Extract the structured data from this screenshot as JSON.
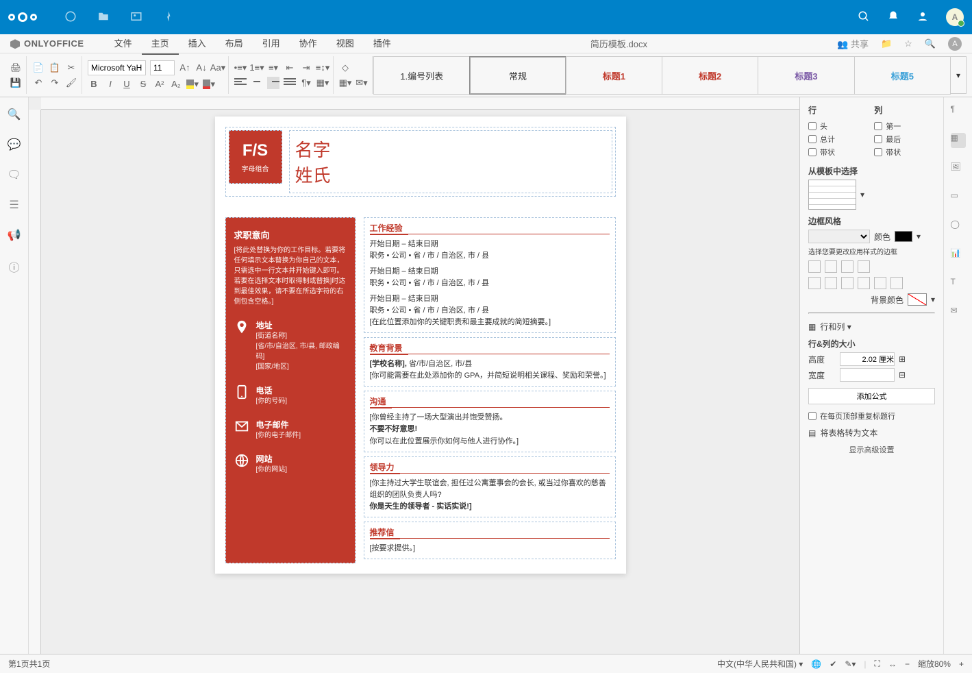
{
  "nextcloud_user_initial": "A",
  "oo": {
    "brand": "ONLYOFFICE",
    "doc_title": "简历模板.docx",
    "share": "共享",
    "user_initial": "A"
  },
  "tabs": [
    "文件",
    "主页",
    "插入",
    "布局",
    "引用",
    "协作",
    "视图",
    "插件"
  ],
  "active_tab": 1,
  "font": {
    "name": "Microsoft YaH",
    "size": "11"
  },
  "styles": [
    {
      "label": "1.编号列表",
      "color": "#333"
    },
    {
      "label": "常规",
      "color": "#333",
      "selected": true
    },
    {
      "label": "标题1",
      "color": "#c0392b",
      "bold": true
    },
    {
      "label": "标题2",
      "color": "#c0392b",
      "bold": true
    },
    {
      "label": "标题3",
      "color": "#7b5aa6",
      "bold": true
    },
    {
      "label": "标题5",
      "color": "#3aa0d8",
      "bold": true
    }
  ],
  "doc": {
    "fs": "F/S",
    "fs_sub": "字母组合",
    "first_name": "名字",
    "last_name": "姓氏",
    "objective_title": "求职意向",
    "objective_text": "[将此处替换为你的工作目标。若要将任何填示文本替换为你自己的文本，只需选中一行文本并开始键入即可。若要在选择文本时取得制或替换]时达到最佳效果，请不要在所选字符的右侧包含空格。]",
    "contacts": [
      {
        "icon": "pin",
        "title": "地址",
        "lines": [
          "[街道名称]",
          "[省/市/自治区, 市/县, 邮政编码]",
          "[国家/地区]"
        ]
      },
      {
        "icon": "phone",
        "title": "电话",
        "lines": [
          "[你的号码]"
        ]
      },
      {
        "icon": "mail",
        "title": "电子邮件",
        "lines": [
          "[你的电子邮件]"
        ]
      },
      {
        "icon": "globe",
        "title": "网站",
        "lines": [
          "[你的网站]"
        ]
      }
    ],
    "sections": {
      "work": {
        "title": "工作经验",
        "items": [
          {
            "date": "开始日期 – 结束日期",
            "line": "职务 • 公司 • 省 / 市 / 自治区, 市 / 县"
          },
          {
            "date": "开始日期 – 结束日期",
            "line": "职务 • 公司 • 省 / 市 / 自治区, 市 / 县"
          },
          {
            "date": "开始日期 – 结束日期",
            "line": "职务 • 公司 • 省 / 市 / 自治区, 市 / 县",
            "extra": "[在此位置添加你的关键职责和最主要成就的简短摘要。]"
          }
        ]
      },
      "edu": {
        "title": "教育背景",
        "school": "[学校名称],",
        "loc": "省/市/自治区, 市/县",
        "extra": "[你可能需要在此处添加你的 GPA，并简短说明相关课程、奖励和荣誉。]"
      },
      "comm": {
        "title": "沟通",
        "l1": "[你曾经主持了一场大型演出并饱受赞扬。",
        "l2": "不要不好意思!",
        "l3": "你可以在此位置展示你如何与他人进行协作。]"
      },
      "lead": {
        "title": "领导力",
        "l1": "[你主持过大学生联谊会, 担任过公寓董事会的会长, 或当过你喜欢的慈善组织的团队负责人吗?",
        "l2": "你是天生的领导者 - 实话实说!]"
      },
      "ref": {
        "title": "推荐信",
        "l1": "[按要求提供。]"
      }
    }
  },
  "panel": {
    "row_h": "行",
    "col_h": "列",
    "row_opts": [
      "头",
      "总计",
      "带状"
    ],
    "col_opts": [
      "第一",
      "最后",
      "带状"
    ],
    "tmpl": "从模板中选择",
    "border_style": "边框风格",
    "color_lbl": "颜色",
    "border_hint": "选择您要更改应用样式的边框",
    "bg_lbl": "背景颜色",
    "rows_cols": "行和列",
    "size_h": "行&列的大小",
    "height": "高度",
    "height_val": "2.02 厘米",
    "width": "宽度",
    "add_formula": "添加公式",
    "repeat_header": "在每页顶部重复标题行",
    "to_text": "将表格转为文本",
    "advanced": "显示高级设置"
  },
  "status": {
    "page": "第1页共1页",
    "lang": "中文(中华人民共和国)",
    "zoom": "缩放80%"
  }
}
